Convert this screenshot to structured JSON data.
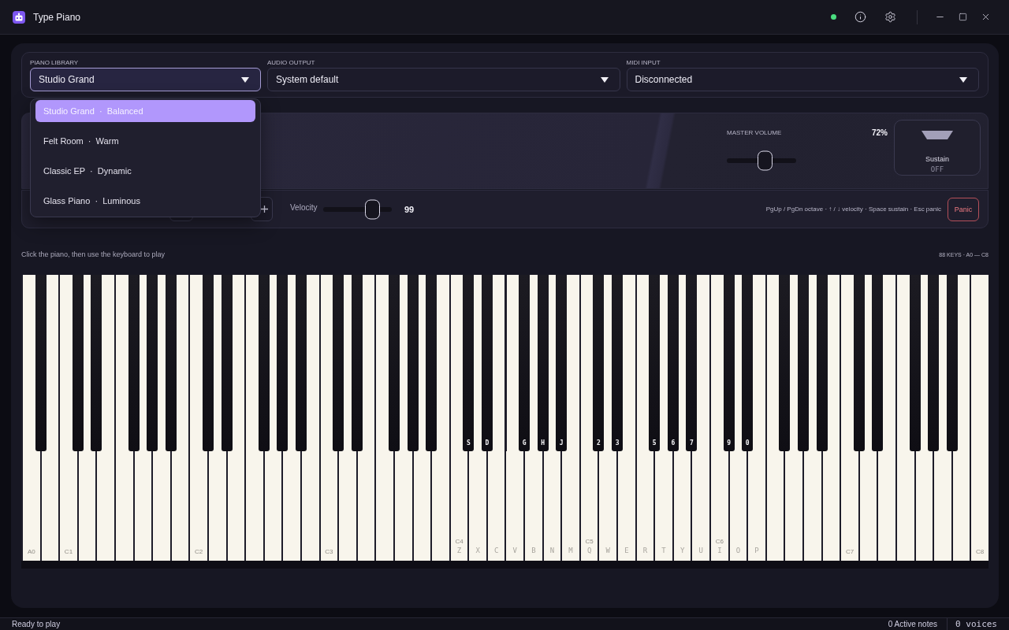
{
  "window": {
    "title": "Type Piano"
  },
  "devices": {
    "fields": [
      {
        "label": "PIANO LIBRARY",
        "value": "Studio Grand",
        "open": true,
        "options": [
          {
            "label": "Studio Grand  ·  Balanced",
            "selected": true
          },
          {
            "label": "Felt Room  ·  Warm",
            "selected": false
          },
          {
            "label": "Classic EP  ·  Dynamic",
            "selected": false
          },
          {
            "label": "Glass Piano  ·  Luminous",
            "selected": false
          }
        ]
      },
      {
        "label": "AUDIO OUTPUT",
        "value": "System default",
        "open": false
      },
      {
        "label": "MIDI INPUT",
        "value": "Disconnected",
        "open": false
      }
    ]
  },
  "master": {
    "label": "MASTER VOLUME",
    "reading": "72%",
    "level": 0.57
  },
  "sustain": {
    "label": "Sustain",
    "state": "OFF",
    "on": false
  },
  "performance": {
    "velocity": {
      "label": "Velocity",
      "level": 0.78,
      "reading": "99"
    },
    "shortcuts": "PgUp / PgDn octave · ↑ / ↓ velocity · Space sustain · Esc panic",
    "panic": "Panic"
  },
  "keyboard": {
    "hint": "Click the piano, then use the keyboard to play",
    "range": "88 KEYS · A0 — C8",
    "keys": [
      {
        "kind": "white",
        "note": "A0"
      },
      {
        "kind": "black"
      },
      {
        "kind": "white"
      },
      {
        "kind": "white",
        "note": "C1"
      },
      {
        "kind": "black"
      },
      {
        "kind": "white"
      },
      {
        "kind": "black"
      },
      {
        "kind": "white"
      },
      {
        "kind": "white"
      },
      {
        "kind": "black"
      },
      {
        "kind": "white"
      },
      {
        "kind": "black"
      },
      {
        "kind": "white"
      },
      {
        "kind": "black"
      },
      {
        "kind": "white"
      },
      {
        "kind": "white",
        "note": "C2"
      },
      {
        "kind": "black"
      },
      {
        "kind": "white"
      },
      {
        "kind": "black"
      },
      {
        "kind": "white"
      },
      {
        "kind": "white"
      },
      {
        "kind": "black"
      },
      {
        "kind": "white"
      },
      {
        "kind": "black"
      },
      {
        "kind": "white"
      },
      {
        "kind": "black"
      },
      {
        "kind": "white"
      },
      {
        "kind": "white",
        "note": "C3"
      },
      {
        "kind": "black"
      },
      {
        "kind": "white"
      },
      {
        "kind": "black"
      },
      {
        "kind": "white"
      },
      {
        "kind": "white"
      },
      {
        "kind": "black"
      },
      {
        "kind": "white"
      },
      {
        "kind": "black"
      },
      {
        "kind": "white"
      },
      {
        "kind": "black"
      },
      {
        "kind": "white"
      },
      {
        "kind": "white",
        "note": "C4",
        "key": "Z"
      },
      {
        "kind": "black",
        "key": "S"
      },
      {
        "kind": "white",
        "key": "X"
      },
      {
        "kind": "black",
        "key": "D"
      },
      {
        "kind": "white",
        "key": "C"
      },
      {
        "kind": "white",
        "key": "V"
      },
      {
        "kind": "black",
        "key": "G"
      },
      {
        "kind": "white",
        "key": "B"
      },
      {
        "kind": "black",
        "key": "H"
      },
      {
        "kind": "white",
        "key": "N"
      },
      {
        "kind": "black",
        "key": "J"
      },
      {
        "kind": "white",
        "key": "M"
      },
      {
        "kind": "white",
        "note": "C5",
        "key": "Q"
      },
      {
        "kind": "black",
        "key": "2"
      },
      {
        "kind": "white",
        "key": "W"
      },
      {
        "kind": "black",
        "key": "3"
      },
      {
        "kind": "white",
        "key": "E"
      },
      {
        "kind": "white",
        "key": "R"
      },
      {
        "kind": "black",
        "key": "5"
      },
      {
        "kind": "white",
        "key": "T"
      },
      {
        "kind": "black",
        "key": "6"
      },
      {
        "kind": "white",
        "key": "Y"
      },
      {
        "kind": "black",
        "key": "7"
      },
      {
        "kind": "white",
        "key": "U"
      },
      {
        "kind": "white",
        "note": "C6",
        "key": "I"
      },
      {
        "kind": "black",
        "key": "9"
      },
      {
        "kind": "white",
        "key": "O"
      },
      {
        "kind": "black",
        "key": "0"
      },
      {
        "kind": "white",
        "key": "P"
      },
      {
        "kind": "white"
      },
      {
        "kind": "black"
      },
      {
        "kind": "white"
      },
      {
        "kind": "black"
      },
      {
        "kind": "white"
      },
      {
        "kind": "black"
      },
      {
        "kind": "white"
      },
      {
        "kind": "white",
        "note": "C7"
      },
      {
        "kind": "black"
      },
      {
        "kind": "white"
      },
      {
        "kind": "black"
      },
      {
        "kind": "white"
      },
      {
        "kind": "white"
      },
      {
        "kind": "black"
      },
      {
        "kind": "white"
      },
      {
        "kind": "black"
      },
      {
        "kind": "white"
      },
      {
        "kind": "black"
      },
      {
        "kind": "white"
      },
      {
        "kind": "white",
        "note": "C8"
      }
    ]
  },
  "status_bar": {
    "status": "Ready to play",
    "active_notes": "0 Active notes",
    "voices": "0 voices"
  }
}
